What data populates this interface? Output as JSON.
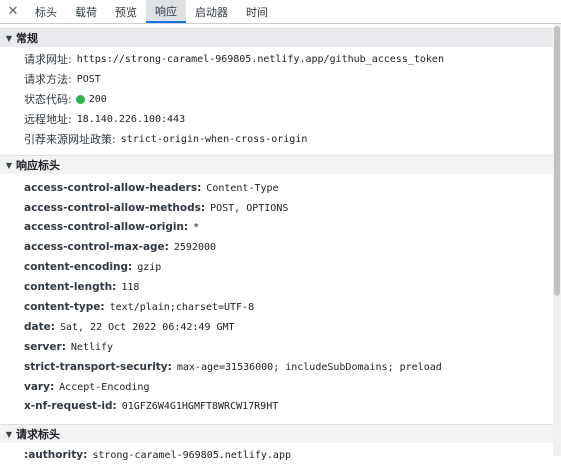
{
  "tabs": [
    "标头",
    "载荷",
    "预览",
    "响应",
    "启动器",
    "时间"
  ],
  "active_tab": "响应",
  "general": {
    "title": "常规",
    "rows": [
      {
        "key": "请求网址:",
        "value": "https://strong-caramel-969805.netlify.app/github_access_token"
      },
      {
        "key": "请求方法:",
        "value": "POST"
      },
      {
        "key": "状态代码:",
        "value": "200",
        "status_color": "#2fb34a"
      },
      {
        "key": "远程地址:",
        "value": "18.140.226.100:443"
      },
      {
        "key": "引荐来源网址政策:",
        "value": "strict-origin-when-cross-origin"
      }
    ]
  },
  "response_headers": {
    "title": "响应标头",
    "rows": [
      {
        "key": "access-control-allow-headers:",
        "value": "Content-Type"
      },
      {
        "key": "access-control-allow-methods:",
        "value": "POST, OPTIONS"
      },
      {
        "key": "access-control-allow-origin:",
        "value": "*"
      },
      {
        "key": "access-control-max-age:",
        "value": "2592000"
      },
      {
        "key": "content-encoding:",
        "value": "gzip"
      },
      {
        "key": "content-length:",
        "value": "118"
      },
      {
        "key": "content-type:",
        "value": "text/plain;charset=UTF-8"
      },
      {
        "key": "date:",
        "value": "Sat, 22 Oct 2022 06:42:49 GMT"
      },
      {
        "key": "server:",
        "value": "Netlify"
      },
      {
        "key": "strict-transport-security:",
        "value": "max-age=31536000; includeSubDomains; preload"
      },
      {
        "key": "vary:",
        "value": "Accept-Encoding"
      },
      {
        "key": "x-nf-request-id:",
        "value": "01GFZ6W4G1HGMFT8WRCW17R9HT"
      }
    ]
  },
  "request_headers": {
    "title": "请求标头",
    "rows": [
      {
        "key": ":authority:",
        "value": "strong-caramel-969805.netlify.app"
      }
    ]
  }
}
